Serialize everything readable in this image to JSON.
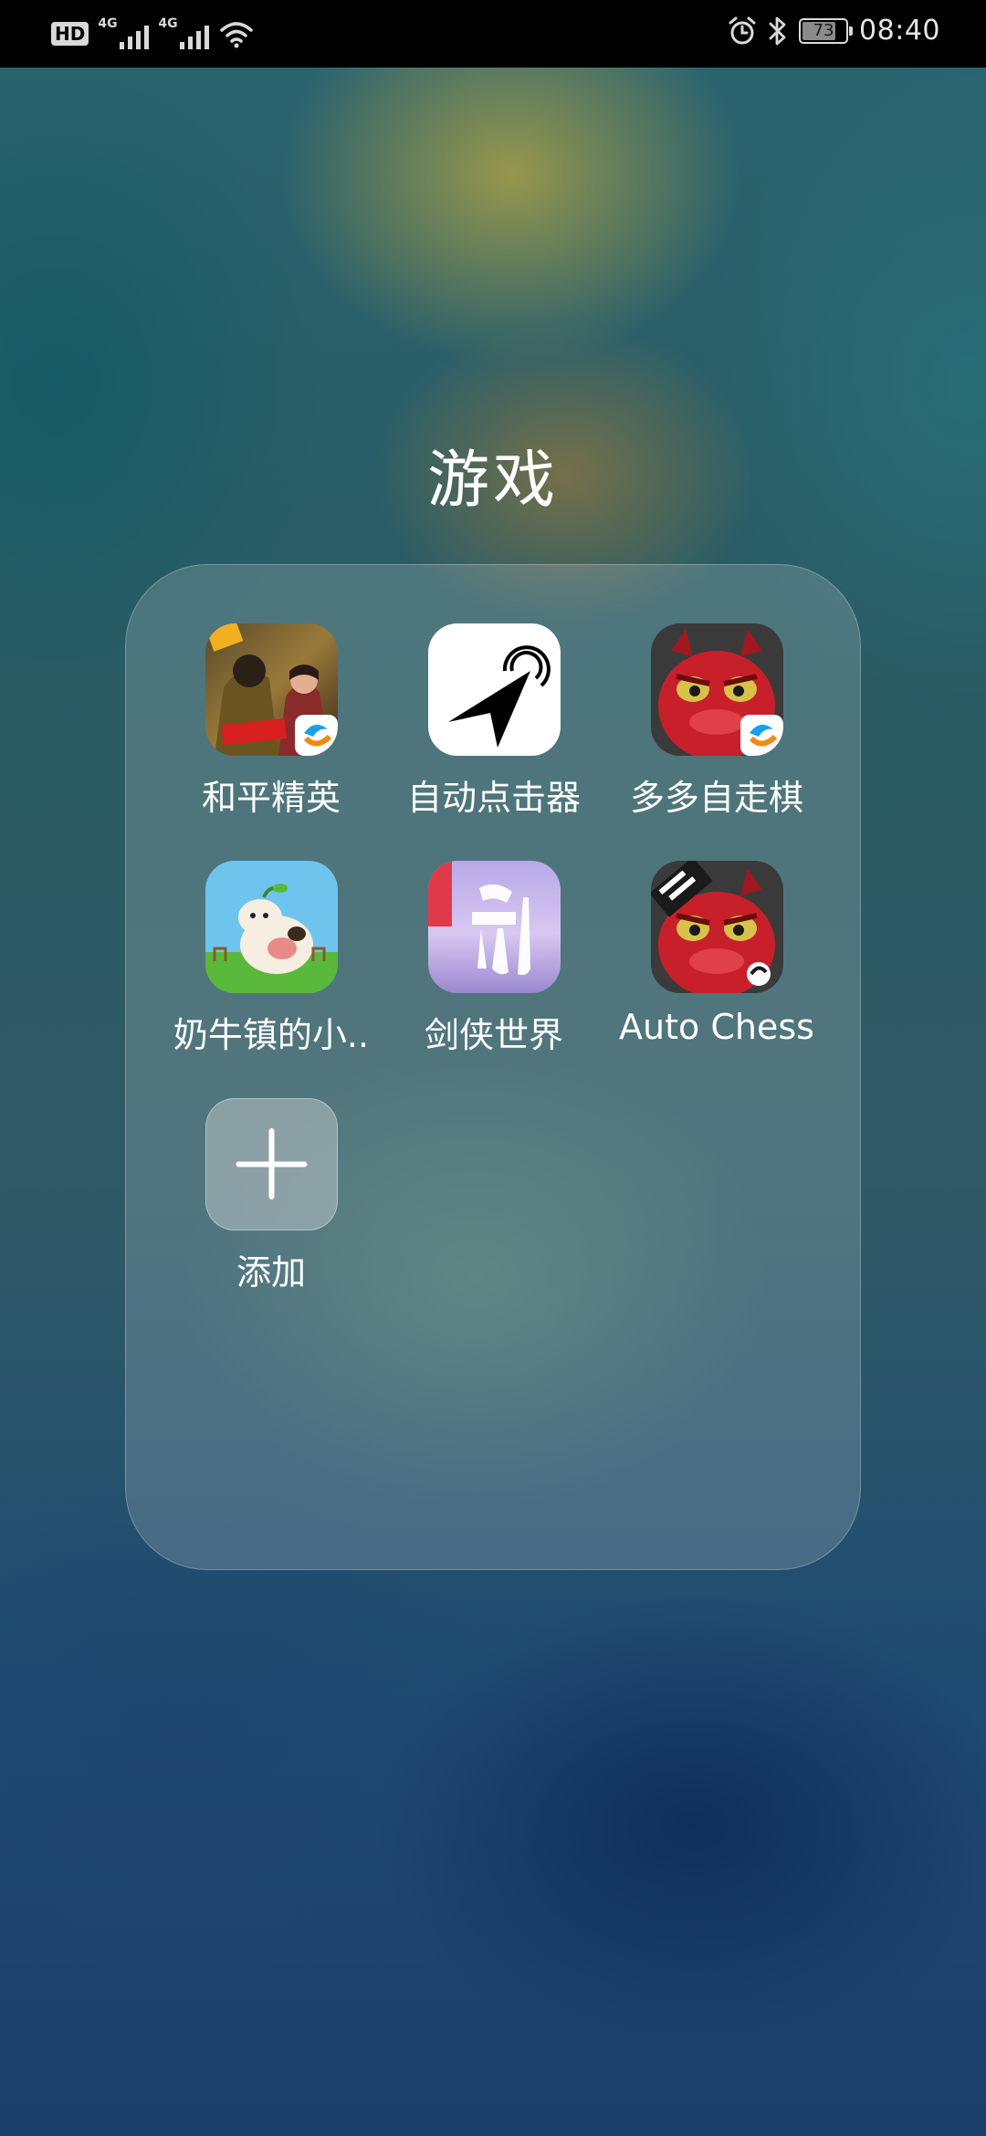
{
  "status_bar": {
    "hd_label": "HD",
    "sim1_tag": "4G",
    "sim2_tag": "4G",
    "battery_level": "73",
    "time": "08:40"
  },
  "folder": {
    "title": "游戏",
    "apps": [
      {
        "label": "和平精英",
        "icon": "peace-elite-icon"
      },
      {
        "label": "自动点击器",
        "icon": "auto-clicker-icon"
      },
      {
        "label": "多多自走棋",
        "icon": "dodo-auto-chess-icon"
      },
      {
        "label": "奶牛镇的小..",
        "icon": "cow-town-icon"
      },
      {
        "label": "剑侠世界",
        "icon": "jianxia-world-icon"
      },
      {
        "label": "Auto Chess",
        "icon": "auto-chess-icon"
      }
    ],
    "add_label": "添加",
    "colors": {
      "panel_tint": "#dce1e1",
      "add_tile": "#9aa7a8",
      "dragon_red": "#c8202a",
      "clicker_bg": "#ffffff"
    }
  }
}
